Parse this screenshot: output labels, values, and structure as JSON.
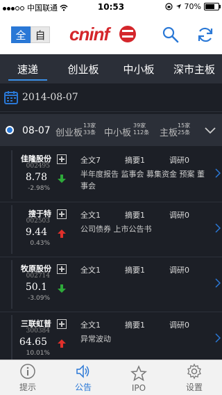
{
  "status": {
    "carrier": "中国联通",
    "time": "10:53",
    "battery": "70%"
  },
  "header": {
    "toggle_all": "全",
    "toggle_self": "自",
    "logo": "cninf"
  },
  "tabs": [
    {
      "label": "速递"
    },
    {
      "label": "创业板"
    },
    {
      "label": "中小板"
    },
    {
      "label": "深市主板"
    }
  ],
  "date_label": "2014-08-07",
  "group": {
    "date": "08-07",
    "categories": [
      {
        "label": "创业板",
        "count_companies": "13家",
        "count_items": "33条"
      },
      {
        "label": "中小板",
        "count_companies": "39家",
        "count_items": "112条"
      },
      {
        "label": "主板",
        "count_companies": "15家",
        "count_items": "25条"
      }
    ]
  },
  "rows": [
    {
      "name": "佳隆股份",
      "code": "002495",
      "price": "8.78",
      "change": "-2.98%",
      "direction": "down",
      "fulltext": "全文7",
      "summary": "摘要1",
      "research": "调研0",
      "tags": "半年度报告 监事会 募集资金 预案 董事会"
    },
    {
      "name": "搜于特",
      "code": "002503",
      "price": "9.44",
      "change": "0.43%",
      "direction": "up",
      "fulltext": "全文1",
      "summary": "摘要1",
      "research": "调研0",
      "tags": "公司债券 上市公告书"
    },
    {
      "name": "牧原股份",
      "code": "002714",
      "price": "50.1",
      "change": "-3.09%",
      "direction": "down",
      "fulltext": "全文1",
      "summary": "摘要1",
      "research": "调研0",
      "tags": ""
    },
    {
      "name": "三联虹普",
      "code": "300384",
      "price": "64.65",
      "change": "10.01%",
      "direction": "up",
      "fulltext": "全文1",
      "summary": "摘要1",
      "research": "调研0",
      "tags": "异常波动"
    }
  ],
  "nav": [
    {
      "label": "提示",
      "icon": "info-icon"
    },
    {
      "label": "公告",
      "icon": "speaker-icon"
    },
    {
      "label": "IPO",
      "icon": "star-icon"
    },
    {
      "label": "设置",
      "icon": "gear-icon"
    }
  ],
  "colors": {
    "accent": "#2a78d6",
    "up": "#e0302b",
    "down": "#2eaa3a",
    "logo": "#d4262b"
  }
}
